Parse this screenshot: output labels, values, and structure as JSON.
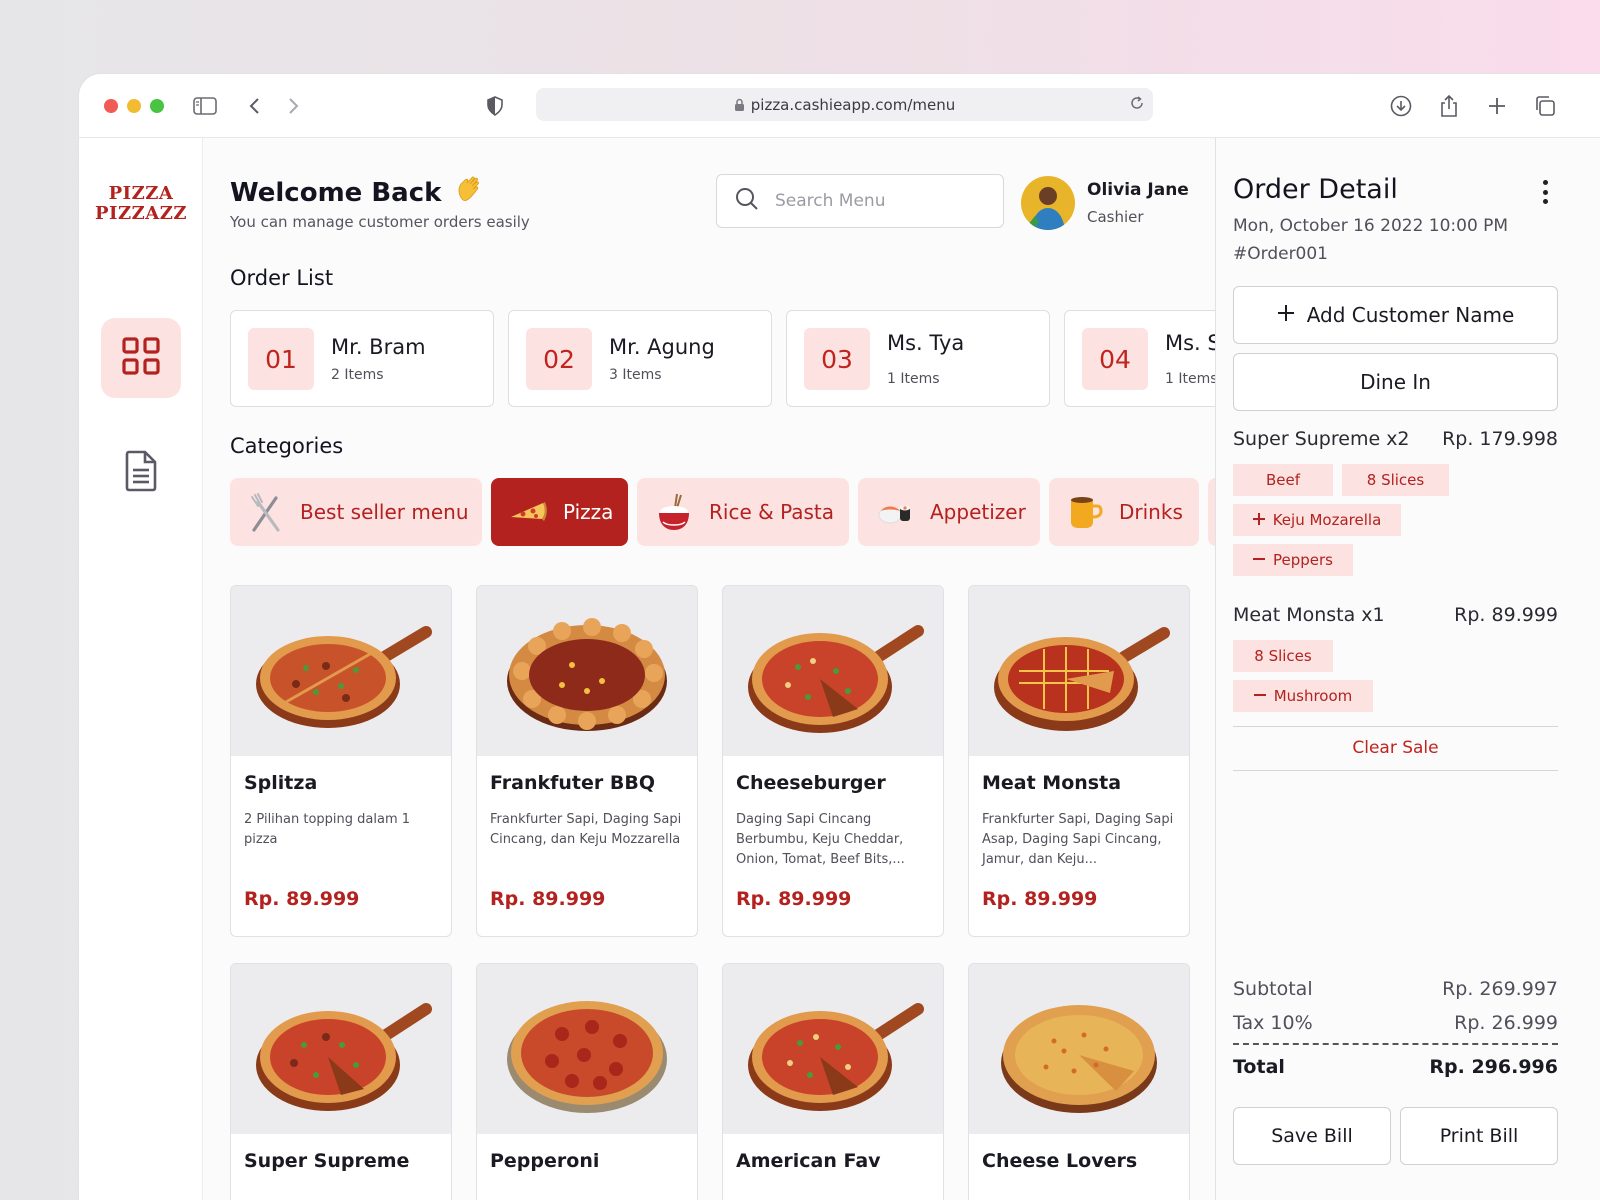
{
  "browser": {
    "url": "pizza.cashieapp.com/menu"
  },
  "sidebar": {
    "logo_line1": "PIZZA",
    "logo_line2": "PIZZAZZ",
    "items": [
      {
        "icon": "grid-icon",
        "active": true
      },
      {
        "icon": "document-icon",
        "active": false
      }
    ]
  },
  "header": {
    "welcome": "Welcome Back",
    "subtitle": "You can manage customer orders easily",
    "search_placeholder": "Search Menu",
    "user_name": "Olivia Jane",
    "user_role": "Cashier"
  },
  "order_list": {
    "title": "Order List",
    "orders": [
      {
        "num": "01",
        "name": "Mr. Bram",
        "items": "2 Items"
      },
      {
        "num": "02",
        "name": "Mr. Agung",
        "items": "3 Items"
      },
      {
        "num": "03",
        "name": "Ms. Tya",
        "items": "1 Items"
      },
      {
        "num": "04",
        "name": "Ms. S",
        "items": "1 Items"
      }
    ]
  },
  "categories": {
    "title": "Categories",
    "items": [
      {
        "label": "Best seller menu",
        "icon": "utensils-icon",
        "active": false
      },
      {
        "label": "Pizza",
        "icon": "pizza-slice-icon",
        "active": true
      },
      {
        "label": "Rice & Pasta",
        "icon": "rice-bowl-icon",
        "active": false
      },
      {
        "label": "Appetizer",
        "icon": "sushi-icon",
        "active": false
      },
      {
        "label": "Drinks",
        "icon": "mug-icon",
        "active": false
      }
    ]
  },
  "menu": {
    "items": [
      {
        "name": "Splitza",
        "desc": "2 Pilihan topping dalam 1 pizza",
        "price": "Rp. 89.999"
      },
      {
        "name": "Frankfuter BBQ",
        "desc": "Frankfurter Sapi, Daging Sapi Cincang, dan Keju Mozzarella",
        "price": "Rp. 89.999"
      },
      {
        "name": "Cheeseburger",
        "desc": "Daging Sapi Cincang Berbumbu, Keju Cheddar, Onion, Tomat, Beef Bits,...",
        "price": "Rp. 89.999"
      },
      {
        "name": "Meat Monsta",
        "desc": "Frankfurter Sapi, Daging Sapi Asap, Daging Sapi Cincang, Jamur, dan Keju...",
        "price": "Rp. 89.999"
      },
      {
        "name": "Super Supreme",
        "desc": "",
        "price": ""
      },
      {
        "name": "Pepperoni",
        "desc": "",
        "price": ""
      },
      {
        "name": "American Fav",
        "desc": "",
        "price": ""
      },
      {
        "name": "Cheese Lovers",
        "desc": "",
        "price": ""
      }
    ]
  },
  "order_detail": {
    "title": "Order Detail",
    "date": "Mon, October 16 2022 10:00 PM",
    "order_id": "#Order001",
    "add_customer": "Add Customer Name",
    "dine_in": "Dine In",
    "lines": [
      {
        "name": "Super Supreme x2",
        "price": "Rp. 179.998",
        "tags": [
          "Beef",
          "8 Slices",
          "Keju Mozarella",
          "Peppers"
        ]
      },
      {
        "name": "Meat Monsta x1",
        "price": "Rp. 89.999",
        "tags": [
          "8 Slices",
          "Mushroom"
        ]
      }
    ],
    "clear_sale": "Clear Sale",
    "subtotal_label": "Subtotal",
    "subtotal": "Rp. 269.997",
    "tax_label": "Tax 10%",
    "tax": "Rp. 26.999",
    "total_label": "Total",
    "total": "Rp. 296.996",
    "save_bill": "Save Bill",
    "print_bill": "Print Bill"
  },
  "colors": {
    "brand": "#b3221e",
    "brand_light": "#fde2e2"
  }
}
